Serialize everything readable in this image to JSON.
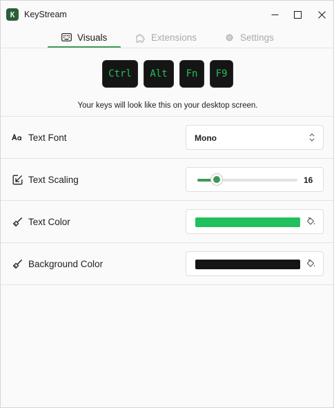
{
  "app": {
    "title": "KeyStream",
    "icon_letter": "K"
  },
  "window_controls": [
    "minimize",
    "maximize",
    "close"
  ],
  "tabs": [
    {
      "label": "Visuals",
      "icon": "keyboard-icon",
      "active": true
    },
    {
      "label": "Extensions",
      "icon": "puzzle-icon",
      "active": false
    },
    {
      "label": "Settings",
      "icon": "gear-icon",
      "active": false
    }
  ],
  "preview": {
    "keys": [
      "Ctrl",
      "Alt",
      "Fn",
      "F9"
    ],
    "caption": "Your keys will look like this on your desktop screen."
  },
  "settings": {
    "font": {
      "label": "Text Font",
      "icon": "font-icon",
      "value": "Mono"
    },
    "scaling": {
      "label": "Text Scaling",
      "icon": "resize-icon",
      "value": "16",
      "slider_fraction": 0.19
    },
    "text_color": {
      "label": "Text Color",
      "icon": "brush-icon",
      "color": "#22c05c"
    },
    "background_color": {
      "label": "Background Color",
      "icon": "brush-icon",
      "color": "#151515"
    }
  },
  "colors": {
    "accent": "#3d9a56",
    "key_text": "#23c05c",
    "key_background": "#151515"
  }
}
